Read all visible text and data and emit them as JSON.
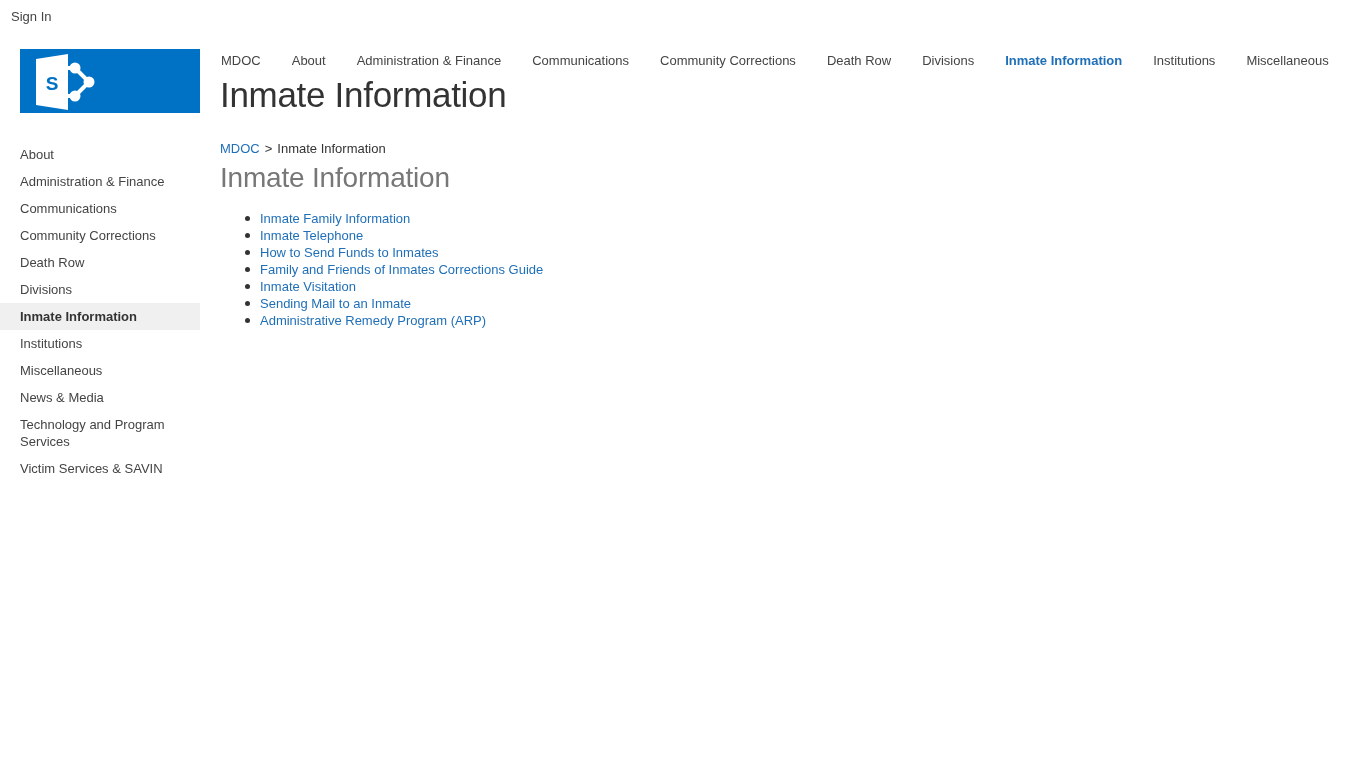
{
  "header": {
    "sign_in": "Sign In"
  },
  "logo": {
    "letter": "S"
  },
  "top_nav": [
    {
      "label": "MDOC",
      "selected": false
    },
    {
      "label": "About",
      "selected": false
    },
    {
      "label": "Administration & Finance",
      "selected": false
    },
    {
      "label": "Communications",
      "selected": false
    },
    {
      "label": "Community Corrections",
      "selected": false
    },
    {
      "label": "Death Row",
      "selected": false
    },
    {
      "label": "Divisions",
      "selected": false
    },
    {
      "label": "Inmate Information",
      "selected": true
    },
    {
      "label": "Institutions",
      "selected": false
    },
    {
      "label": "Miscellaneous",
      "selected": false
    }
  ],
  "site_title": "Inmate Information",
  "side_nav": [
    {
      "label": "About",
      "selected": false
    },
    {
      "label": "Administration & Finance",
      "selected": false
    },
    {
      "label": "Communications",
      "selected": false
    },
    {
      "label": "Community Corrections",
      "selected": false
    },
    {
      "label": "Death Row",
      "selected": false
    },
    {
      "label": "Divisions",
      "selected": false
    },
    {
      "label": "Inmate Information",
      "selected": true
    },
    {
      "label": "Institutions",
      "selected": false
    },
    {
      "label": "Miscellaneous",
      "selected": false
    },
    {
      "label": "News & Media",
      "selected": false
    },
    {
      "label": "Technology and Program Services",
      "selected": false
    },
    {
      "label": "Victim Services & SAVIN",
      "selected": false
    }
  ],
  "breadcrumb": [
    {
      "label": "MDOC",
      "kind": "link"
    },
    {
      "label": ">",
      "kind": "separator"
    },
    {
      "label": "Inmate Information",
      "kind": "current"
    }
  ],
  "page_title": "Inmate Information",
  "links": [
    "Inmate Family Information",
    "Inmate Telephone",
    "How to Send Funds to Inmates",
    "Family and Friends of Inmates Corrections Guide",
    "Inmate Visitation",
    "Sending Mail to an Inmate",
    "Administrative Remedy Program (ARP)"
  ]
}
